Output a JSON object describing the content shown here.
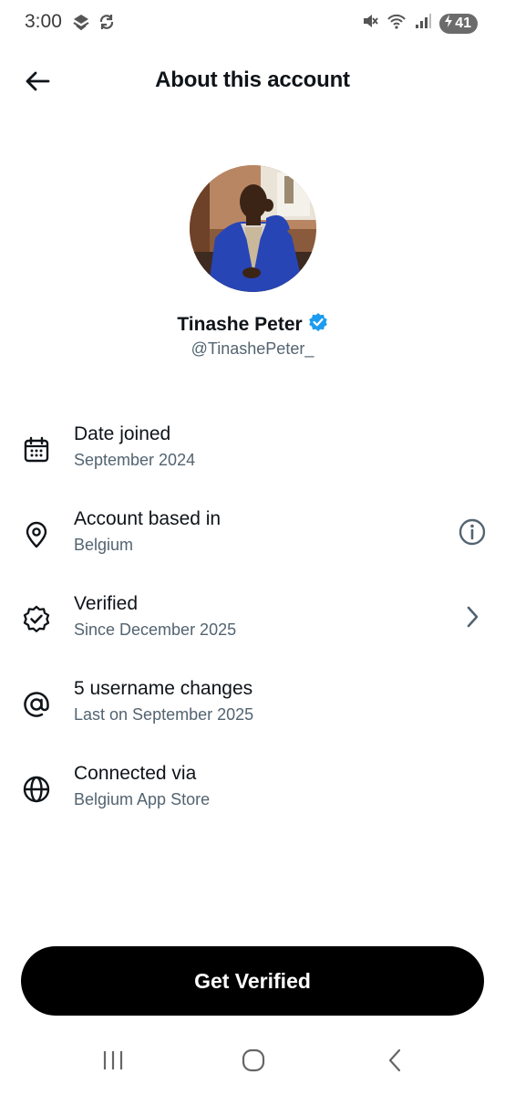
{
  "status_bar": {
    "time": "3:00",
    "battery_level": "41"
  },
  "header": {
    "title": "About this account"
  },
  "profile": {
    "name": "Tinashe Peter",
    "handle": "@TinashePeter_",
    "verified_badge_color": "#1d9bf0"
  },
  "rows": [
    {
      "icon": "calendar-icon",
      "title": "Date joined",
      "subtitle": "September 2024"
    },
    {
      "icon": "location-pin-icon",
      "title": "Account based in",
      "subtitle": "Belgium",
      "trailing": "info-icon"
    },
    {
      "icon": "verified-check-icon",
      "title": "Verified",
      "subtitle": "Since December 2025",
      "trailing": "chevron-right-icon"
    },
    {
      "icon": "at-sign-icon",
      "title": "5 username changes",
      "subtitle": "Last on September 2025"
    },
    {
      "icon": "globe-icon",
      "title": "Connected via",
      "subtitle": "Belgium App Store"
    }
  ],
  "cta": {
    "label": "Get Verified"
  },
  "colors": {
    "primary_text": "#0f1419",
    "secondary_text": "#536471",
    "cta_background": "#000000",
    "cta_text": "#ffffff"
  }
}
